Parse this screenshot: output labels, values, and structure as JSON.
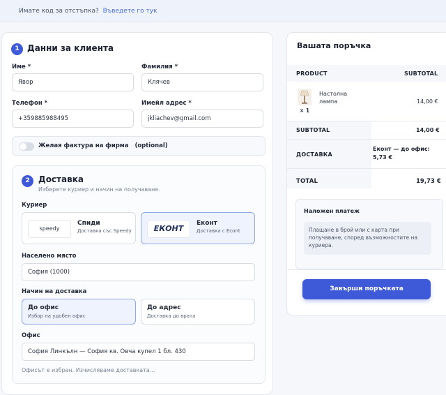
{
  "coupon": {
    "question": "Имате код за отстъпка?",
    "link": "Въведете го тук"
  },
  "customer": {
    "step": "1",
    "title": "Данни за клиента",
    "first_name": {
      "label": "Име *",
      "value": "Явор"
    },
    "last_name": {
      "label": "Фамилия *",
      "value": "Клячев"
    },
    "phone": {
      "label": "Телефон *",
      "value": "+359885988495"
    },
    "email": {
      "label": "Имейл адрес *",
      "value": "jkliachev@gmail.com"
    },
    "invoice": {
      "label": "Желая фактура на фирма",
      "optional": "(optional)"
    }
  },
  "delivery": {
    "step": "2",
    "title": "Доставка",
    "subtitle": "Изберете куриер и начин на получаване.",
    "courier_label": "Куриер",
    "couriers": [
      {
        "logo": "speedy",
        "name": "Спиди",
        "desc": "Доставка със Speedy"
      },
      {
        "logo": "ЕКОНТ",
        "name": "Еконт",
        "desc": "Доставка с Econt"
      }
    ],
    "place_label": "Населено място",
    "place_value": "София (1000)",
    "method_label": "Начин на доставка",
    "methods": [
      {
        "name": "До офис",
        "desc": "Избор на удобен офис"
      },
      {
        "name": "До адрес",
        "desc": "Доставка до врата"
      }
    ],
    "office_label": "Офис",
    "office_value": "София Линкълн — София кв. Овча купел 1 бл. 430",
    "status": "Офисът е избран. Изчисляваме доставката..."
  },
  "order": {
    "title": "Вашата поръчка",
    "col_product": "PRODUCT",
    "col_subtotal": "SUBTOTAL",
    "item": {
      "name": "Настолна лампа",
      "qty": "× 1",
      "price": "14,00 €"
    },
    "subtotal_label": "SUBTOTAL",
    "subtotal_value": "14,00 €",
    "shipping_label": "ДОСТАВКА",
    "shipping_value": "Еконт — до офис: 5,73 €",
    "total_label": "TOTAL",
    "total_value": "19,73 €",
    "payment_title": "Наложен платеж",
    "payment_info": "Плащане в брой или с карта при получаване, според възможностите на куриера.",
    "submit": "Завърши поръчката"
  },
  "colors": {
    "accent": "#3f5ad8",
    "selected_border": "#8fa7e6"
  },
  "icons": {
    "toggle": "toggle-switch",
    "lamp": "lamp-thumbnail"
  }
}
